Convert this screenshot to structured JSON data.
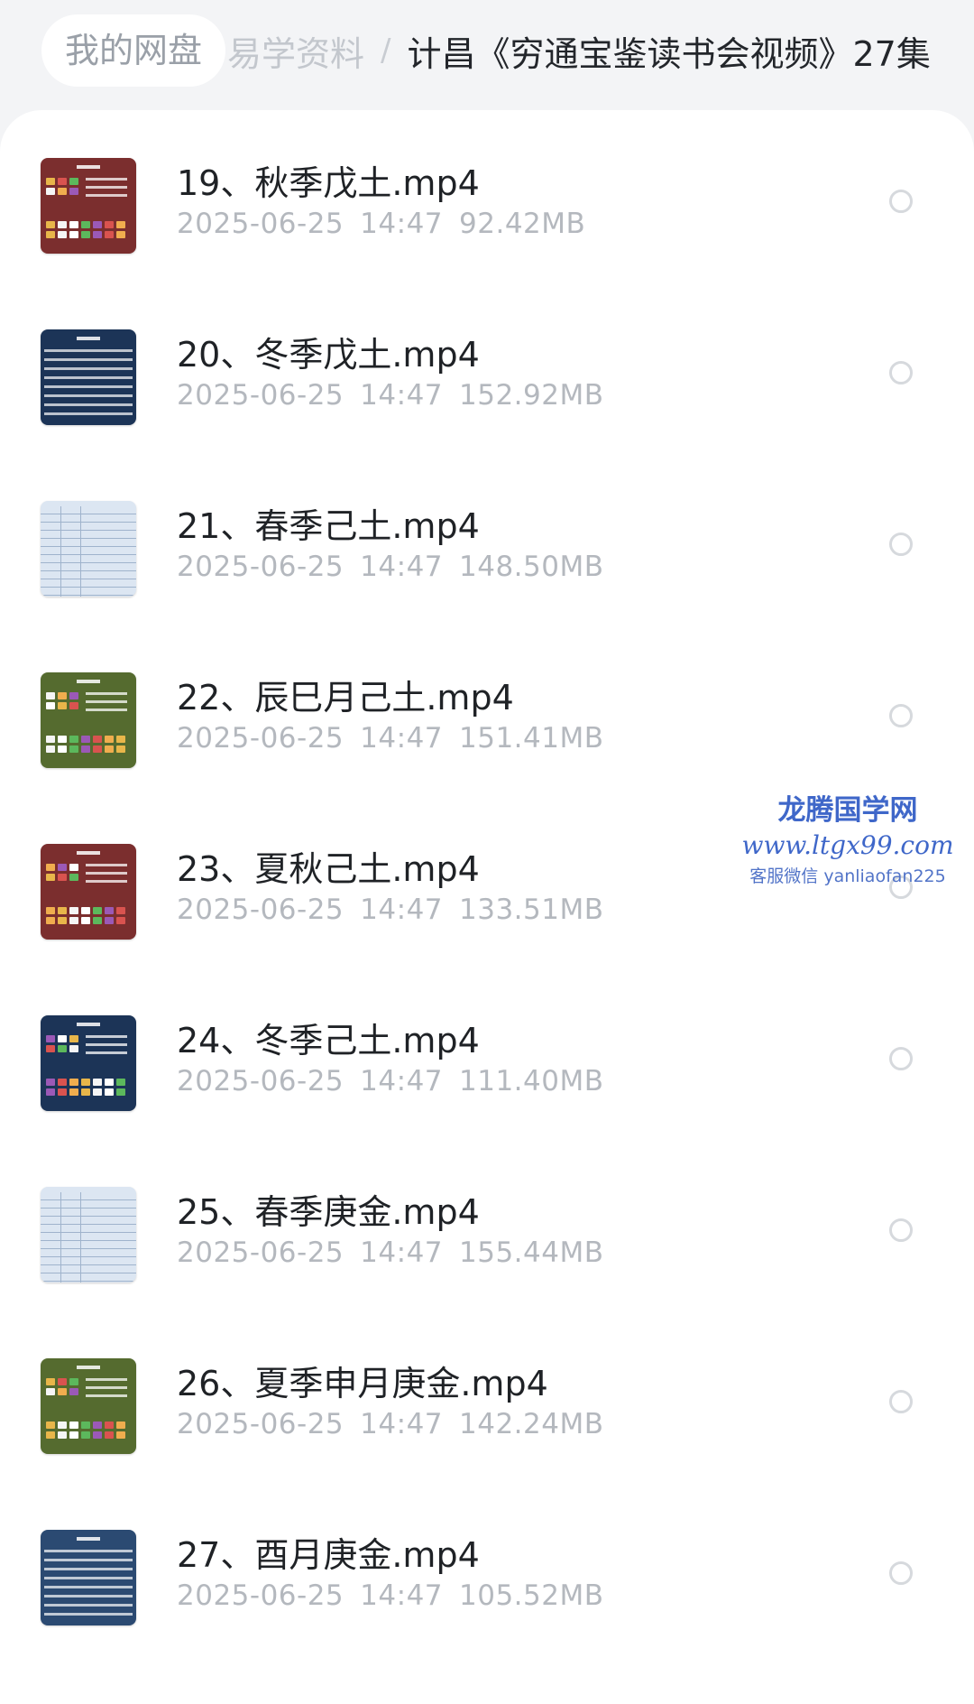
{
  "breadcrumb": {
    "root": "我的网盘",
    "middle": "易学资料",
    "separator": "/",
    "current": "计昌《穷通宝鉴读书会视频》27集"
  },
  "files": [
    {
      "name": "19、秋季戊土.mp4",
      "date": "2025-06-25",
      "time": "14:47",
      "size": "92.42MB",
      "thumb_style": "tiles",
      "thumb_color": "#7b2e2e"
    },
    {
      "name": "20、冬季戊土.mp4",
      "date": "2025-06-25",
      "time": "14:47",
      "size": "152.92MB",
      "thumb_style": "text",
      "thumb_color": "#1c3457"
    },
    {
      "name": "21、春季己土.mp4",
      "date": "2025-06-25",
      "time": "14:47",
      "size": "148.50MB",
      "thumb_style": "table",
      "thumb_color": "#dce6f2"
    },
    {
      "name": "22、辰巳月己土.mp4",
      "date": "2025-06-25",
      "time": "14:47",
      "size": "151.41MB",
      "thumb_style": "tiles",
      "thumb_color": "#556b2f"
    },
    {
      "name": "23、夏秋己土.mp4",
      "date": "2025-06-25",
      "time": "14:47",
      "size": "133.51MB",
      "thumb_style": "tiles",
      "thumb_color": "#7b2e2e"
    },
    {
      "name": "24、冬季己土.mp4",
      "date": "2025-06-25",
      "time": "14:47",
      "size": "111.40MB",
      "thumb_style": "tiles",
      "thumb_color": "#1c3457"
    },
    {
      "name": "25、春季庚金.mp4",
      "date": "2025-06-25",
      "time": "14:47",
      "size": "155.44MB",
      "thumb_style": "table",
      "thumb_color": "#dce6f2"
    },
    {
      "name": "26、夏季申月庚金.mp4",
      "date": "2025-06-25",
      "time": "14:47",
      "size": "142.24MB",
      "thumb_style": "tiles",
      "thumb_color": "#556b2f"
    },
    {
      "name": "27、酉月庚金.mp4",
      "date": "2025-06-25",
      "time": "14:47",
      "size": "105.52MB",
      "thumb_style": "text",
      "thumb_color": "#2b4a72"
    }
  ],
  "watermark": {
    "title": "龙腾国学网",
    "url": "www.ltgx99.com",
    "contact": "客服微信 yanliaofan225"
  },
  "colors": {
    "tile_palette": [
      "#e8b64a",
      "#d9534f",
      "#5cb85c",
      "#f5f5f5",
      "#f0ad4e",
      "#9b59b6",
      "#ffffff"
    ]
  }
}
